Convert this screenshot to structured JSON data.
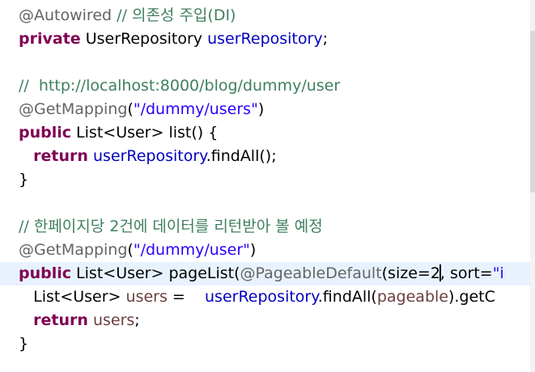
{
  "colors": {
    "annotation": "#646464",
    "keyword": "#7f0055",
    "field": "#0000c0",
    "string": "#2a00ff",
    "comment": "#3f7f5f",
    "parameter": "#6a3e3e",
    "plain": "#000000",
    "current_line_bg": "#e8f2fe"
  },
  "editor": {
    "lines": [
      {
        "tokens": [
          {
            "t": "@Autowired",
            "c": "annotation"
          },
          {
            "t": " ",
            "c": "plain"
          },
          {
            "t": "// 의존성 주입(DI)",
            "c": "comment"
          }
        ]
      },
      {
        "tokens": [
          {
            "t": "private",
            "c": "keyword"
          },
          {
            "t": " UserRepository ",
            "c": "plain"
          },
          {
            "t": "userRepository",
            "c": "field"
          },
          {
            "t": ";",
            "c": "plain"
          }
        ]
      },
      {
        "tokens": []
      },
      {
        "tokens": [
          {
            "t": "//  http://localhost:8000/blog/dummy/user",
            "c": "comment"
          }
        ]
      },
      {
        "tokens": [
          {
            "t": "@GetMapping",
            "c": "annotation"
          },
          {
            "t": "(",
            "c": "plain"
          },
          {
            "t": "\"/dummy/users\"",
            "c": "string"
          },
          {
            "t": ")",
            "c": "plain"
          }
        ]
      },
      {
        "tokens": [
          {
            "t": "public",
            "c": "keyword"
          },
          {
            "t": " List<User> list() {",
            "c": "plain"
          }
        ]
      },
      {
        "tokens": [
          {
            "t": "   ",
            "c": "plain"
          },
          {
            "t": "return",
            "c": "keyword"
          },
          {
            "t": " ",
            "c": "plain"
          },
          {
            "t": "userRepository",
            "c": "field"
          },
          {
            "t": ".findAll();",
            "c": "plain"
          }
        ]
      },
      {
        "tokens": [
          {
            "t": "}",
            "c": "plain"
          }
        ]
      },
      {
        "tokens": []
      },
      {
        "tokens": [
          {
            "t": "// 한페이지당 2건에 데이터를 리턴받아 볼 예정",
            "c": "comment"
          }
        ]
      },
      {
        "tokens": [
          {
            "t": "@GetMapping",
            "c": "annotation"
          },
          {
            "t": "(",
            "c": "plain"
          },
          {
            "t": "\"/dummy/user\"",
            "c": "string"
          },
          {
            "t": ")",
            "c": "plain"
          }
        ]
      },
      {
        "current": true,
        "tokens": [
          {
            "t": "public",
            "c": "keyword"
          },
          {
            "t": " List<User> pageList(",
            "c": "plain"
          },
          {
            "t": "@PageableDefault",
            "c": "annotation"
          },
          {
            "t": "(size=2",
            "c": "plain"
          },
          {
            "caret": true
          },
          {
            "t": ", sort=",
            "c": "plain"
          },
          {
            "t": "\"i",
            "c": "string"
          }
        ]
      },
      {
        "tokens": [
          {
            "t": "   List<User> ",
            "c": "plain"
          },
          {
            "t": "users",
            "c": "parameter"
          },
          {
            "t": " =    ",
            "c": "plain"
          },
          {
            "t": "userRepository",
            "c": "field"
          },
          {
            "t": ".findAll(",
            "c": "plain"
          },
          {
            "t": "pageable",
            "c": "parameter"
          },
          {
            "t": ").getC",
            "c": "plain"
          }
        ]
      },
      {
        "tokens": [
          {
            "t": "   ",
            "c": "plain"
          },
          {
            "t": "return",
            "c": "keyword"
          },
          {
            "t": " ",
            "c": "plain"
          },
          {
            "t": "users",
            "c": "parameter"
          },
          {
            "t": ";",
            "c": "plain"
          }
        ]
      },
      {
        "tokens": [
          {
            "t": "}",
            "c": "plain"
          }
        ]
      }
    ]
  }
}
